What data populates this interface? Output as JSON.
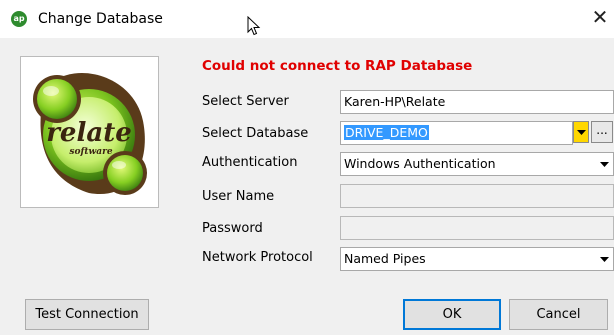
{
  "window": {
    "title": "Change Database",
    "app_icon_text": "ap",
    "close_glyph": "✕"
  },
  "logo": {
    "text": "relate",
    "subtext": "software",
    "colors": {
      "green_light": "#b7e33a",
      "green_dark": "#3d8a12",
      "brown": "#5a3b1a"
    }
  },
  "error": {
    "message": "Could not connect to RAP Database",
    "color": "#e00000"
  },
  "form": {
    "server": {
      "label": "Select Server",
      "value": "Karen-HP\\Relate"
    },
    "database": {
      "label": "Select Database",
      "value": "DRIVE_DEMO",
      "browse_label": "..."
    },
    "authentication": {
      "label": "Authentication",
      "value": "Windows Authentication"
    },
    "username": {
      "label": "User Name",
      "value": ""
    },
    "password": {
      "label": "Password",
      "value": ""
    },
    "protocol": {
      "label": "Network Protocol",
      "value": "Named Pipes"
    }
  },
  "buttons": {
    "test": "Test Connection",
    "ok": "OK",
    "cancel": "Cancel"
  },
  "accent": {
    "selection": "#3399ff",
    "focus_border": "#0078d7",
    "combo_yellow": "#ffd700"
  }
}
